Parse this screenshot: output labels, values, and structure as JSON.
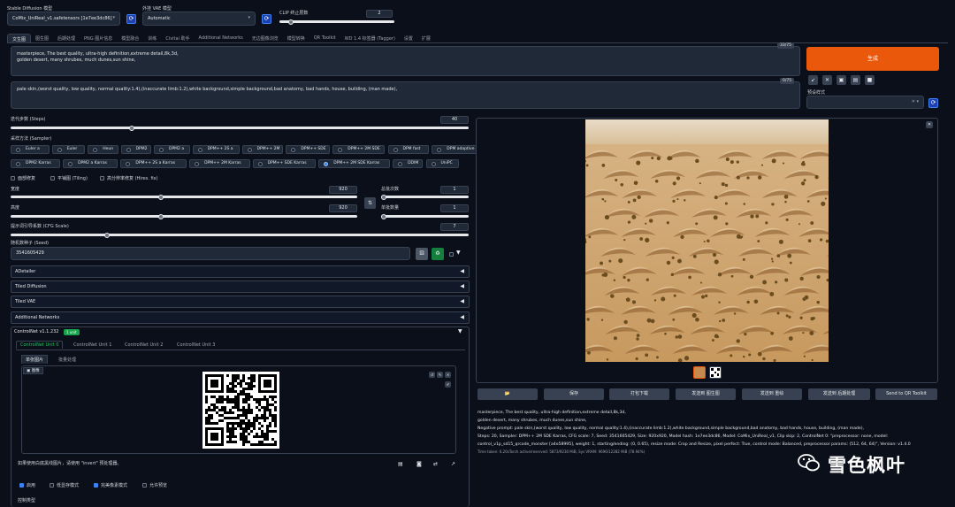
{
  "header": {
    "model_label": "Stable Diffusion 模型",
    "model_value": "CoMix_UniReal_v1.safetensors [1e7ee3dc86]",
    "vae_label": "外挂 VAE 模型",
    "vae_value": "Automatic",
    "clip_label": "CLIP 终止层数",
    "clip_value": "2",
    "clip_fraction": 0.08
  },
  "tabs": [
    "文生图",
    "图生图",
    "后期处理",
    "PNG 图片信息",
    "模型融合",
    "训练",
    "Civitai 助手",
    "Additional Networks",
    "无边图像浏览",
    "模型转换",
    "QR Toolkit",
    "WD 1.4 标签器 (Tagger)",
    "设置",
    "扩展"
  ],
  "prompt": {
    "text1": "masterpiece, The best quality, ultra-high definition,extreme detail,8k,3d,",
    "text2": "golden desert, many shrubes,  much dunes,sun shine,",
    "counter": "33/75"
  },
  "negative": {
    "text": "pale skin,(worst quality, low quality, normal quality:1.4),(inaccurate limb:1.2),white background,simple background,bad anatomy, bad hands, house, building, (man made),",
    "counter": "0/75"
  },
  "generate_label": "生成",
  "style_label": "预设样式",
  "steps": {
    "label": "迭代步数 (Steps)",
    "value": "40",
    "fraction": 0.28
  },
  "sampler": {
    "label": "采样方法 (Sampler)",
    "row1": [
      "Euler a",
      "Euler",
      "Heun",
      "DPM2",
      "DPM2 a",
      "DPM++ 2S a",
      "DPM++ 2M",
      "DPM++ SDE",
      "DPM++ 2M SDE",
      "DPM fast",
      "DPM adaptive",
      "LMS Karras"
    ],
    "row2": [
      "DPM2 Karras",
      "DPM2 a Karras",
      "DPM++ 2S a Karras",
      "DPM++ 2M Karras",
      "DPM++ SDE Karras",
      "DPM++ 2M SDE Karras",
      "DDIM",
      "UniPC"
    ],
    "selected": "DPM++ 2M SDE Karras"
  },
  "checks": {
    "restore": "面部修复",
    "tiling": "平铺图 (Tiling)",
    "hires": "高分辨率修复 (Hires. fix)"
  },
  "width": {
    "label": "宽度",
    "value": "920",
    "fraction": 0.43
  },
  "height": {
    "label": "高度",
    "value": "920",
    "fraction": 0.43
  },
  "batch_count": {
    "label": "总批次数",
    "value": "1",
    "fraction": 0.0
  },
  "batch_size": {
    "label": "单批数量",
    "value": "1",
    "fraction": 0.0
  },
  "cfg": {
    "label": "提示词引导系数 (CFG Scale)",
    "value": "7",
    "fraction": 0.22
  },
  "seed": {
    "label": "随机数种子 (Seed)",
    "value": "3541605429"
  },
  "accordions": [
    "ADetailer",
    "Tiled Diffusion",
    "Tiled VAE",
    "Additional Networks"
  ],
  "controlnet": {
    "title": "ControlNet v1.1.232",
    "badge": "1 unit",
    "units": [
      "ControlNet Unit 0",
      "ControlNet Unit 1",
      "ControlNet Unit 2",
      "ControlNet Unit 3"
    ],
    "subtabs": [
      "单张图片",
      "批量处理"
    ],
    "image_label": "图像",
    "hint": "如果使用白底黑线图片，请使用 \"invert\" 预处理器。",
    "enable": "启用",
    "lowvram": "低显存模式",
    "pixel_perfect": "完美像素模式",
    "preview": "允许预览",
    "control_type": "控制类型"
  },
  "output": {
    "buttons": [
      "📂",
      "保存",
      "打包下载",
      "发送到 图生图",
      "发送到 重绘",
      "发送到 后期处理",
      "Send to QR Toolkit"
    ],
    "info": [
      "masterpiece, The best quality, ultra-high definition,extreme detail,8k,3d,",
      "golden desert, many shrubes, much dunes,sun shine,",
      "Negative prompt: pale skin,(worst quality, low quality, normal quality:1.4),(inaccurate limb:1.2),white background,simple background,bad anatomy, bad hands, house, building, (man made),",
      "Steps: 20, Sampler: DPM++ 2M SDE Karras, CFG scale: 7, Seed: 3541605429, Size: 920x920, Model hash: 1e7ee3dc86, Model: CoMix_UniReal_v1, Clip skip: 2, ControlNet 0: \"preprocessor: none, model:",
      "control_v1p_sd15_qrcode_monster [a4e58995], weight: 1, starting/ending: (0, 0.65), resize mode: Crop and Resize, pixel perfect: True, control mode: Balanced, preprocessor params: (512, 64, 64)\", Version: v1.4.0"
    ],
    "time": "Time taken: 6.20sTorch active/reserved: 5873/9230 MiB, Sys VRAM: 9696/12282 MiB (78.94%)"
  },
  "watermark": "雪色枫叶",
  "colors": {
    "accent": "#ea580c",
    "link": "#3b82f6",
    "bg": "#0b0f19",
    "green": "#22c55e"
  }
}
